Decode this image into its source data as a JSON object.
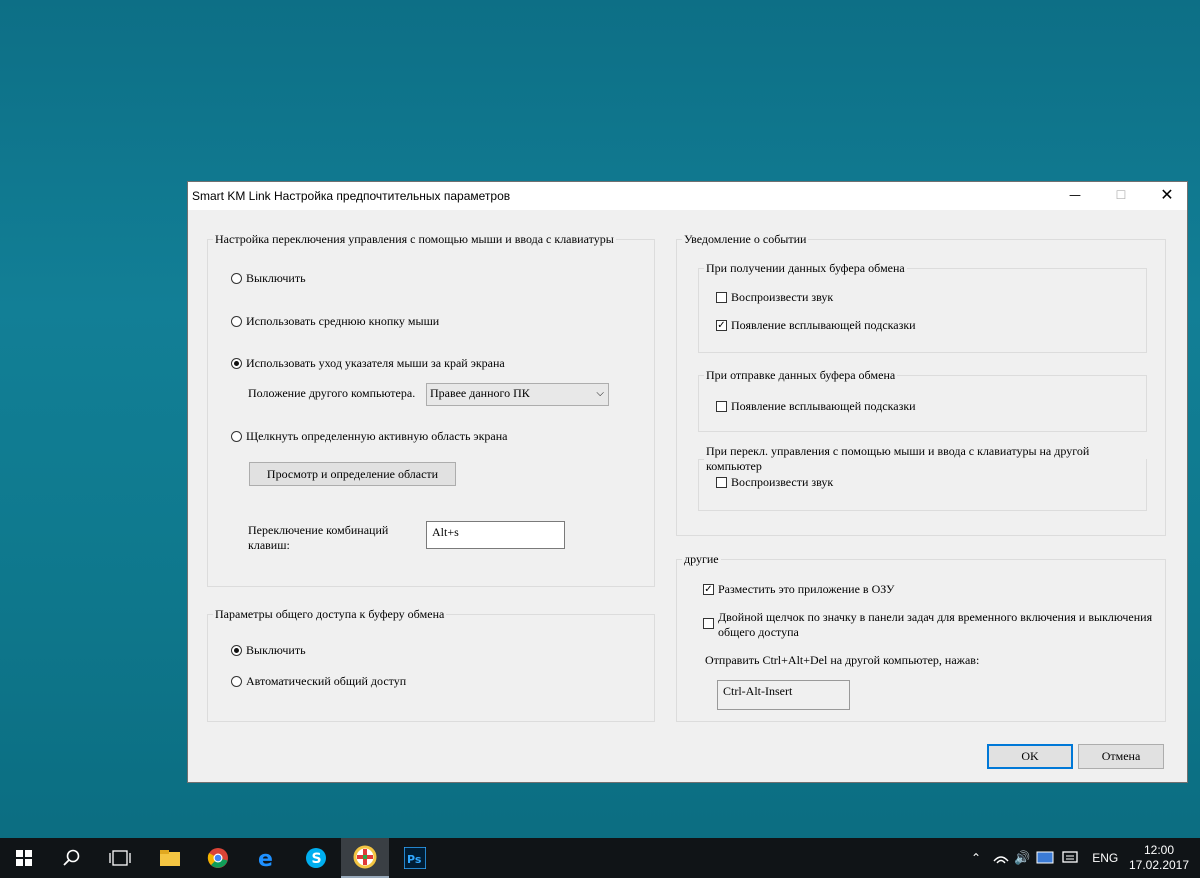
{
  "window": {
    "title": "Smart KM Link Настройка предпочтительных параметров",
    "minimize": "—",
    "maximize": "☐",
    "close": "✕"
  },
  "switch_group": {
    "legend": "Настройка переключения управления с помощью мыши и ввода с клавиатуры",
    "opt_off": "Выключить",
    "opt_middle": "Использовать среднюю кнопку мыши",
    "opt_edge": "Использовать уход указателя мыши за край экрана",
    "position_label": "Положение другого компьютера.",
    "position_value": "Правее данного ПК",
    "opt_area": "Щелкнуть определенную активную область экрана",
    "area_button": "Просмотр и определение области",
    "hotkey_label_1": "Переключение комбинаций",
    "hotkey_label_2": "клавиш:",
    "hotkey_value": "Alt+s"
  },
  "clipboard_group": {
    "legend": "Параметры общего доступа к буферу обмена",
    "opt_off": "Выключить",
    "opt_auto": "Автоматический общий доступ"
  },
  "notify_group": {
    "legend": "Уведомление о событии",
    "receive": {
      "legend": "При получении данных буфера обмена",
      "sound": "Воспроизвести звук",
      "popup": "Появление всплывающей подсказки"
    },
    "send": {
      "legend": "При отправке данных буфера обмена",
      "popup": "Появление всплывающей подсказки"
    },
    "switch": {
      "legend": "При перекл. управления с помощью мыши и ввода с клавиатуры на другой компьютер",
      "sound": "Воспроизвести звук"
    }
  },
  "other_group": {
    "legend": "другие",
    "ram": "Разместить это приложение в ОЗУ",
    "dblclick_1": "Двойной щелчок по значку в панели задач для временного включения и выключения",
    "dblclick_2": "общего доступа",
    "cad_label": "Отправить Ctrl+Alt+Del на другой компьютер, нажав:",
    "cad_value": "Ctrl-Alt-Insert"
  },
  "buttons": {
    "ok": "OK",
    "cancel": "Отмена"
  },
  "taskbar": {
    "lang": "ENG",
    "time": "12:00",
    "date": "17.02.2017"
  },
  "colors": {
    "accent": "#0078d7",
    "desktop": "#127f96",
    "taskbar": "#101417"
  }
}
